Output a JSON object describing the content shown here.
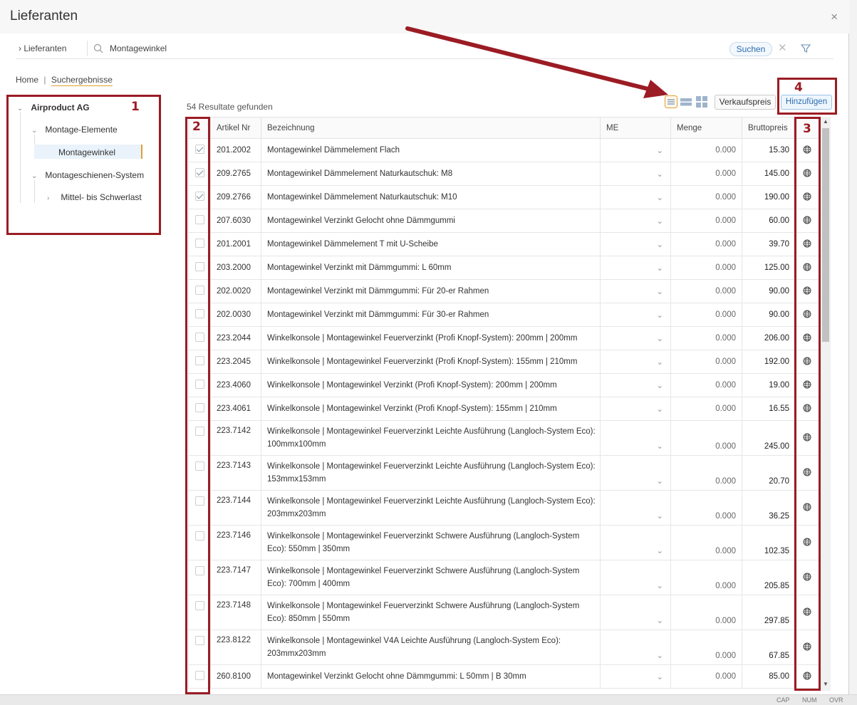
{
  "window": {
    "title": "Lieferanten",
    "close": "×"
  },
  "search": {
    "crumb": "› Lieferanten",
    "value": "Montagewinkel",
    "button": "Suchen",
    "clear": "✕"
  },
  "breadcrumb": {
    "home": "Home",
    "separator": "|",
    "current": "Suchergebnisse"
  },
  "tree": {
    "root": "Airproduct AG",
    "group1": "Montage-Elemente",
    "group1_child": "Montagewinkel",
    "group2": "Montageschienen-System",
    "group2_child": "Mittel- bis Schwerlast"
  },
  "results_count": "54 Resultate gefunden",
  "toolbar": {
    "verkaufspreis": "Verkaufspreis",
    "hinzufuegen": "Hinzufügen"
  },
  "columns": {
    "artikel": "Artikel Nr",
    "bezeichnung": "Bezeichnung",
    "me": "ME",
    "menge": "Menge",
    "preis": "Bruttopreis"
  },
  "rows": [
    {
      "checked": true,
      "art": "201.2002",
      "desc": "Montagewinkel Dämmelement Flach",
      "menge": "0.000",
      "preis": "15.30"
    },
    {
      "checked": true,
      "art": "209.2765",
      "desc": "Montagewinkel Dämmelement Naturkautschuk: M8",
      "menge": "0.000",
      "preis": "145.00"
    },
    {
      "checked": true,
      "art": "209.2766",
      "desc": "Montagewinkel Dämmelement Naturkautschuk: M10",
      "menge": "0.000",
      "preis": "190.00"
    },
    {
      "checked": false,
      "art": "207.6030",
      "desc": "Montagewinkel Verzinkt Gelocht ohne Dämmgummi",
      "menge": "0.000",
      "preis": "60.00"
    },
    {
      "checked": false,
      "art": "201.2001",
      "desc": "Montagewinkel Dämmelement T mit U-Scheibe",
      "menge": "0.000",
      "preis": "39.70"
    },
    {
      "checked": false,
      "art": "203.2000",
      "desc": "Montagewinkel Verzinkt mit Dämmgummi: L 60mm",
      "menge": "0.000",
      "preis": "125.00"
    },
    {
      "checked": false,
      "art": "202.0020",
      "desc": "Montagewinkel Verzinkt mit Dämmgummi: Für 20-er Rahmen",
      "menge": "0.000",
      "preis": "90.00"
    },
    {
      "checked": false,
      "art": "202.0030",
      "desc": "Montagewinkel Verzinkt mit Dämmgummi: Für 30-er Rahmen",
      "menge": "0.000",
      "preis": "90.00"
    },
    {
      "checked": false,
      "art": "223.2044",
      "desc": "Winkelkonsole | Montagewinkel Feuerverzinkt (Profi Knopf-System): 200mm | 200mm",
      "menge": "0.000",
      "preis": "206.00"
    },
    {
      "checked": false,
      "art": "223.2045",
      "desc": "Winkelkonsole | Montagewinkel Feuerverzinkt (Profi Knopf-System): 155mm | 210mm",
      "menge": "0.000",
      "preis": "192.00"
    },
    {
      "checked": false,
      "art": "223.4060",
      "desc": "Winkelkonsole | Montagewinkel Verzinkt (Profi Knopf-System): 200mm | 200mm",
      "menge": "0.000",
      "preis": "19.00"
    },
    {
      "checked": false,
      "art": "223.4061",
      "desc": "Winkelkonsole | Montagewinkel Verzinkt (Profi Knopf-System): 155mm | 210mm",
      "menge": "0.000",
      "preis": "16.55"
    },
    {
      "checked": false,
      "art": "223.7142",
      "desc": "Winkelkonsole | Montagewinkel Feuerverzinkt Leichte Ausführung (Langloch-System Eco): 100mmx100mm",
      "menge": "0.000",
      "preis": "245.00"
    },
    {
      "checked": false,
      "art": "223.7143",
      "desc": "Winkelkonsole | Montagewinkel Feuerverzinkt Leichte Ausführung (Langloch-System Eco): 153mmx153mm",
      "menge": "0.000",
      "preis": "20.70"
    },
    {
      "checked": false,
      "art": "223.7144",
      "desc": "Winkelkonsole | Montagewinkel Feuerverzinkt Leichte Ausführung (Langloch-System Eco): 203mmx203mm",
      "menge": "0.000",
      "preis": "36.25"
    },
    {
      "checked": false,
      "art": "223.7146",
      "desc": "Winkelkonsole | Montagewinkel Feuerverzinkt Schwere Ausführung (Langloch-System Eco): 550mm | 350mm",
      "menge": "0.000",
      "preis": "102.35"
    },
    {
      "checked": false,
      "art": "223.7147",
      "desc": "Winkelkonsole | Montagewinkel Feuerverzinkt Schwere Ausführung (Langloch-System Eco): 700mm | 400mm",
      "menge": "0.000",
      "preis": "205.85"
    },
    {
      "checked": false,
      "art": "223.7148",
      "desc": "Winkelkonsole | Montagewinkel Feuerverzinkt Schwere Ausführung (Langloch-System Eco): 850mm | 550mm",
      "menge": "0.000",
      "preis": "297.85"
    },
    {
      "checked": false,
      "art": "223.8122",
      "desc": "Winkelkonsole | Montagewinkel V4A Leichte Ausführung (Langloch-System Eco): 203mmx203mm",
      "menge": "0.000",
      "preis": "67.85"
    },
    {
      "checked": false,
      "art": "260.8100",
      "desc": "Montagewinkel Verzinkt Gelocht ohne Dämmgummi: L 50mm | B 30mm",
      "menge": "0.000",
      "preis": "85.00"
    }
  ],
  "annotations": [
    "1",
    "2",
    "3",
    "4"
  ],
  "statusbar": {
    "cap": "CAP",
    "num": "NUM",
    "ovr": "OVR"
  },
  "colors": {
    "annotation": "#9b1c24",
    "accent": "#e0a030",
    "link": "#2b6cb0"
  }
}
